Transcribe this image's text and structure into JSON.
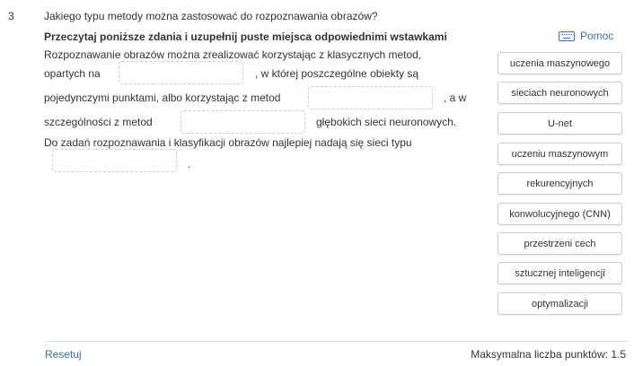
{
  "question": {
    "number": "3",
    "title": "Jakiego typu metody można zastosować do rozpoznawania obrazów?",
    "instruction": "Przeczytaj poniższe zdania i uzupełnij puste miejsca odpowiednimi wstawkami"
  },
  "help": {
    "label": "Pomoc",
    "icon": "keyboard-icon"
  },
  "sentence": {
    "line1": "Rozpoznawanie  obrazów można zrealizować korzystając z klasycznych metod,",
    "line2a": "opartych na",
    "line2b": ", w której poszczególne obiekty są",
    "line3a": "pojedynczymi punktami, albo korzystając z metod",
    "line3b": ", a w",
    "line4a": "szczególności z metod",
    "line4b": "głębokich sieci neuronowych.",
    "line5": "Do zadań rozpoznawania i klasyfikacji obrazów najlepiej nadają się sieci typu",
    "line6": "."
  },
  "words": [
    "uczenia maszynowego",
    "sieciach neuronowych",
    "U-net",
    "uczeniu maszynowym",
    "rekurencyjnych",
    "konwolucyjnego (CNN)",
    "przestrzeni cech",
    "sztucznej inteligencji",
    "optymalizacji"
  ],
  "footer": {
    "reset_label": "Resetuj",
    "max_points": "Maksymalna liczba punktów: 1.5"
  },
  "colors": {
    "link": "#3a6ea5",
    "text": "#333333",
    "border": "#cccccc"
  }
}
